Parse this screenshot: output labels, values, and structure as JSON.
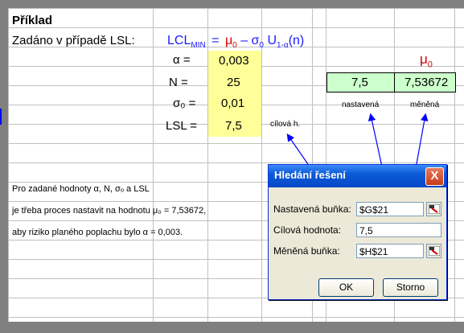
{
  "sheet": {
    "title": "Příklad",
    "given_prefix": "Zadáno v případě LSL:",
    "formula": {
      "lcl": "LCL",
      "lcl_sub": "MIN",
      "eq": "=",
      "mu": "μ",
      "mu_sub": "0",
      "minus": "–",
      "sigma": "σ",
      "sigma_sub": "0",
      "u": "U",
      "u_sub": "1-α",
      "arg": "(n)"
    },
    "params": [
      {
        "label": "α =",
        "value": "0,003"
      },
      {
        "label": "N =",
        "value": "25"
      },
      {
        "label": "σ₀ =",
        "value": "0,01"
      },
      {
        "label": "LSL =",
        "value": "7,5"
      }
    ],
    "target_note": "cílová h.",
    "mu_header": "μ",
    "mu_header_sub": "0",
    "set_value": "7,5",
    "changing_value": "7,53672",
    "set_caption": "nastavená",
    "changing_caption": "měněná",
    "note_lines": [
      "Pro zadané hodnoty α, N, σₒ a LSL",
      "je třeba proces nastavit na hodnotu  μ₀ = 7,53672,",
      "aby riziko planého poplachu bylo α = 0,003."
    ]
  },
  "dialog": {
    "title": "Hledání řešení",
    "close_glyph": "X",
    "set_cell_label": "Nastavená buňka:",
    "set_cell_value": "$G$21",
    "target_value_label": "Cílová hodnota:",
    "target_value_value": "7,5",
    "changing_cell_label": "Měněná buňka:",
    "changing_cell_value": "$H$21",
    "ok_label": "OK",
    "cancel_label": "Storno"
  },
  "colors": {
    "param_fill": "#ffff99",
    "result_fill": "#ccffcc",
    "formula_color": "#1a1aff",
    "mu_color": "#d40000",
    "arrow_color": "#0000ff"
  }
}
